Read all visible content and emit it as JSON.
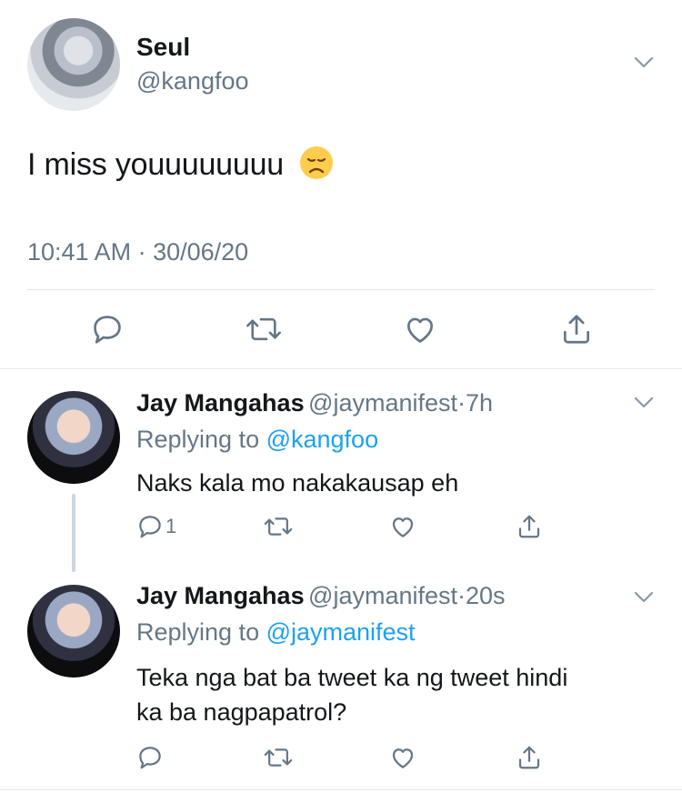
{
  "main_tweet": {
    "author_name": "Seul",
    "author_handle": "@kangfoo",
    "text": "I miss youuuuuuuu",
    "emoji": "😞",
    "timestamp": "10:41 AM · 30/06/20"
  },
  "replies": [
    {
      "name": "Jay Mangahas",
      "handle": "@jaymanifest",
      "dot": "·",
      "time": "7h",
      "replying_prefix": "Replying to ",
      "replying_to": "@kangfoo",
      "text": "Naks kala mo nakakausap eh",
      "reply_count": "1"
    },
    {
      "name": "Jay Mangahas",
      "handle": "@jaymanifest",
      "dot": "·",
      "time": "20s",
      "replying_prefix": "Replying to ",
      "replying_to": "@jaymanifest",
      "text_line1": "Teka nga bat ba tweet ka ng tweet hindi",
      "text_line2": "ka ba nagpapatrol?"
    }
  ],
  "colors": {
    "link": "#1da1f2",
    "secondary_text": "#657786",
    "divider": "#e1e8ed"
  },
  "icons": [
    "chevron-down-icon",
    "reply-icon",
    "retweet-icon",
    "like-icon",
    "share-icon"
  ]
}
